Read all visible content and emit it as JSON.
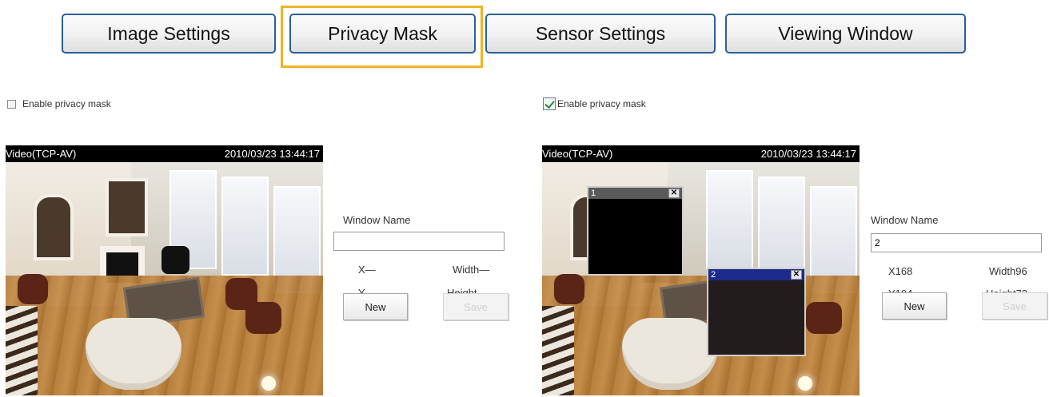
{
  "tabs": [
    {
      "label": "Image Settings"
    },
    {
      "label": "Privacy Mask",
      "selected": true
    },
    {
      "label": "Sensor Settings"
    },
    {
      "label": "Viewing Window"
    }
  ],
  "colors": {
    "tab_border": "#2b5e99",
    "selected_highlight": "#f0b323",
    "mask1_bar": "#5a5a5a",
    "mask2_bar": "#1c2a8a"
  },
  "left_panel": {
    "enable_label": "Enable privacy mask",
    "enabled": false,
    "video_title": "Video(TCP-AV)",
    "timestamp": "2010/03/23 13:44:17",
    "window_name_label": "Window Name",
    "window_name_value": "",
    "x_label": "X—",
    "y_label": "Y—",
    "width_label": "Width—",
    "height_label": "Height—",
    "new_button": "New",
    "save_button": "Save"
  },
  "right_panel": {
    "enable_label": "Enable privacy mask",
    "enabled": true,
    "video_title": "Video(TCP-AV)",
    "timestamp": "2010/03/23 13:44:17",
    "masks": [
      {
        "label": "1",
        "close_glyph": "✕"
      },
      {
        "label": "2",
        "close_glyph": "✕"
      }
    ],
    "window_name_label": "Window Name",
    "window_name_value": "2",
    "x_label": "X168",
    "y_label": "Y104",
    "width_label": "Width96",
    "height_label": "Height72",
    "new_button": "New",
    "save_button": "Save"
  }
}
